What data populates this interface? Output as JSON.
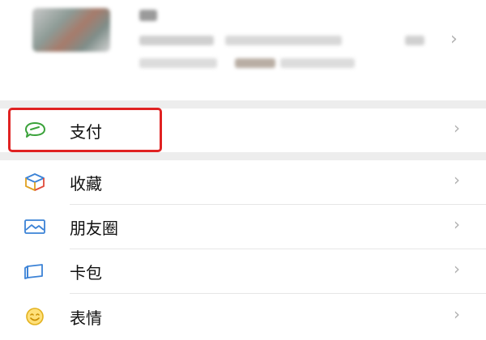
{
  "profile": {
    "chevron": "›"
  },
  "menu": {
    "items": [
      {
        "label": "支付",
        "icon": "pay-icon",
        "chevron": "›"
      },
      {
        "label": "收藏",
        "icon": "favorites-cube-icon",
        "chevron": "›"
      },
      {
        "label": "朋友圈",
        "icon": "moments-picture-icon",
        "chevron": "›"
      },
      {
        "label": "卡包",
        "icon": "card-wallet-icon",
        "chevron": "›"
      },
      {
        "label": "表情",
        "icon": "smiley-icon",
        "chevron": "›"
      }
    ]
  },
  "colors": {
    "highlight": "#e02222",
    "pay_green": "#3aa23a",
    "chevron": "#b2b2b2"
  }
}
